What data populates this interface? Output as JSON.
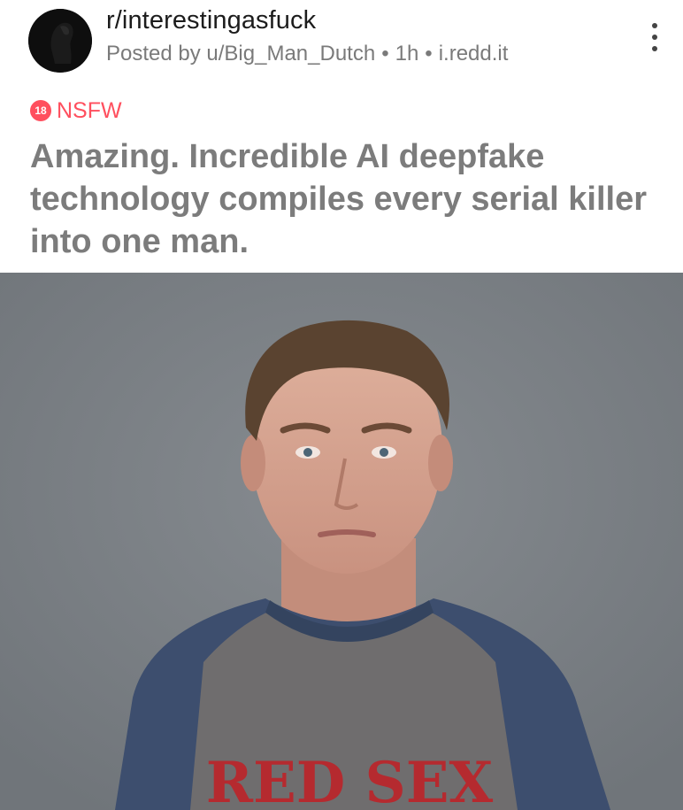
{
  "post": {
    "subreddit": "r/interestingasfuck",
    "posted_by": "Posted by u/Big_Man_Dutch",
    "time": "1h",
    "domain": "i.redd.it",
    "nsfw_badge": "18",
    "nsfw_label": "NSFW",
    "title": "Amazing. Incredible AI deepfake technology compiles every serial killer into one man."
  },
  "image": {
    "shirt_text": "RED SEX",
    "background_color": "#7d8287"
  },
  "colors": {
    "nsfw": "#ff4f5e",
    "title": "#7c7c7c",
    "meta": "#7a7a7a"
  },
  "icons": {
    "avatar": "subreddit-avatar-icon",
    "menu": "more-vertical-icon"
  }
}
